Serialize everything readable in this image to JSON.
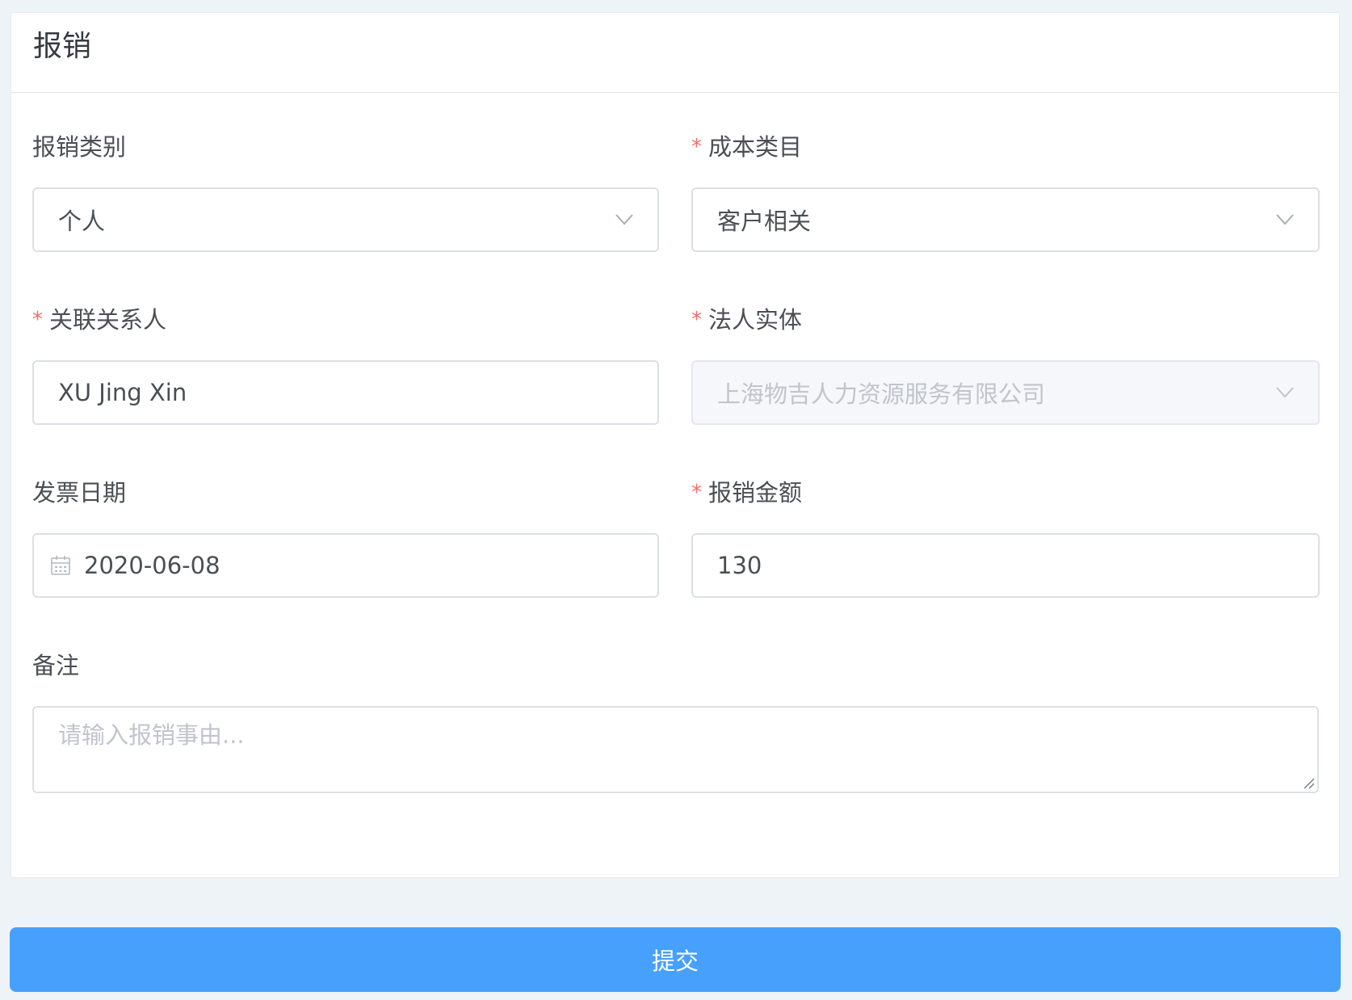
{
  "page": {
    "title": "报销"
  },
  "form": {
    "category": {
      "label": "报销类别",
      "required": false,
      "value": "个人"
    },
    "cost_item": {
      "label": "成本类目",
      "required": true,
      "value": "客户相关"
    },
    "contact": {
      "label": "关联关系人",
      "required": true,
      "value": "XU Jing Xin"
    },
    "entity": {
      "label": "法人实体",
      "required": true,
      "value": "上海物吉人力资源服务有限公司",
      "disabled": true
    },
    "invoice_date": {
      "label": "发票日期",
      "required": false,
      "value": "2020-06-08"
    },
    "amount": {
      "label": "报销金额",
      "required": true,
      "value": "130"
    },
    "remark": {
      "label": "备注",
      "placeholder": "请输入报销事由..."
    },
    "required_mark": "*"
  },
  "actions": {
    "submit_label": "提交"
  },
  "icons": {
    "select_arrow": "chevron-down-icon",
    "date": "calendar-icon",
    "resize": "resize-grip-icon"
  },
  "colors": {
    "primary": "#46a0fc",
    "required": "#f56c6c",
    "background": "#eef3f7"
  }
}
